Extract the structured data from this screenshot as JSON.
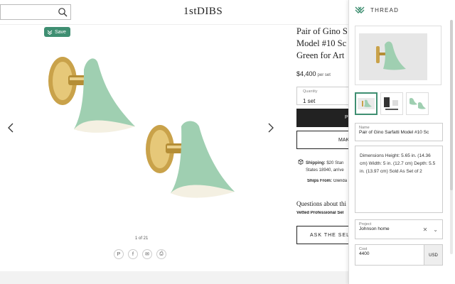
{
  "header": {
    "logo": "1stDIBS",
    "search": {
      "value": "",
      "placeholder": ""
    }
  },
  "gallery": {
    "save_label": "Save",
    "counter": "1 of 21",
    "share": [
      "P",
      "f",
      "✉",
      "⎙"
    ]
  },
  "product": {
    "title_lines": [
      "Pair of Gino S",
      "Model #10 Sc",
      "Green for Art"
    ],
    "price": "$4,400",
    "price_unit": "per set",
    "quantity_label": "Quantity",
    "quantity_value": "1 set",
    "buy_label": "P",
    "offer_label": "MAK",
    "shipping_label": "Shipping:",
    "shipping_text_1": "$20 Stan",
    "shipping_text_2": "States 18940, arrive",
    "ships_from_label": "Ships From:",
    "ships_from_value": "Glenda",
    "questions": "Questions about thi",
    "vetted": "Vetted Professional Sel",
    "ask_label": "ASK THE SELL"
  },
  "thread": {
    "brand": "THREAD",
    "name_label": "Name",
    "name_value": "Pair of Gino Sarfatti Model #10 Sc",
    "description": "Dimensions Height: 5.65 in. (14.36 cm) Width: 5 in. (12.7 cm) Depth: 5.5 in. (13.97 cm) Sold As Set of 2",
    "project_label": "Project",
    "project_value": "Johnson home",
    "cost_label": "Cost",
    "cost_value": "4400",
    "currency": "USD"
  },
  "colors": {
    "accent_green": "#3f8f72",
    "lamp_green": "#9fcfb1",
    "brass": "#c9a24a"
  }
}
